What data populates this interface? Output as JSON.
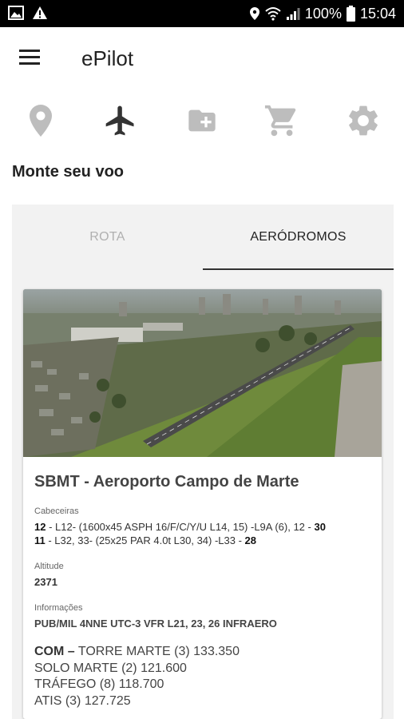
{
  "status_bar": {
    "battery": "100%",
    "time": "15:04"
  },
  "app": {
    "title": "ePilot"
  },
  "toolbar_icons": [
    "location-pin-icon",
    "airplane-icon",
    "folder-add-icon",
    "cart-icon",
    "gear-icon"
  ],
  "page": {
    "title": "Monte seu voo"
  },
  "tabs": [
    {
      "label": "ROTA",
      "active": false
    },
    {
      "label": "AERÓDROMOS",
      "active": true
    }
  ],
  "airport": {
    "name": "SBMT - Aeroporto Campo de Marte",
    "cabeceiras_label": "Cabeceiras",
    "rwy1_start": "12",
    "rwy1_text": " - L12- (1600x45 ASPH 16/F/C/Y/U L14, 15) -L9A (6), 12 - ",
    "rwy1_end": "30",
    "rwy2_start": "11",
    "rwy2_text": " - L32, 33- (25x25 PAR 4.0t L30, 34) -L33 - ",
    "rwy2_end": "28",
    "altitude_label": "Altitude",
    "altitude_value": "2371",
    "info_label": "Informações",
    "info_value": "PUB/MIL 4NNE UTC-3 VFR L21, 23, 26 INFRAERO",
    "com_head": "COM –",
    "com_lines": [
      " TORRE MARTE (3) 133.350",
      "SOLO MARTE (2) 121.600",
      "TRÁFEGO (8) 118.700",
      "ATIS (3) 127.725"
    ]
  },
  "colors": {
    "icon_inactive": "#bdbdbd",
    "icon_active": "#333333",
    "tab_bg": "#f2f2f2"
  }
}
